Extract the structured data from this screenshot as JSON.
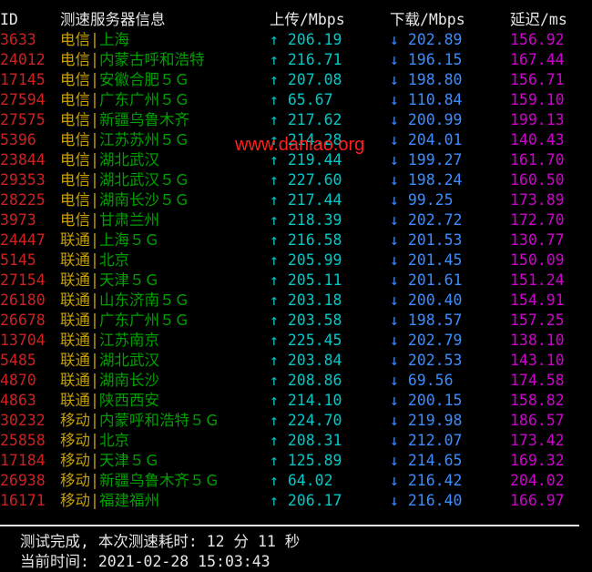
{
  "header": {
    "id": "ID",
    "server": "测速服务器信息",
    "upload": "上传/Mbps",
    "download": "下载/Mbps",
    "latency": "延迟/ms"
  },
  "watermark": "www.daniao.org",
  "rows": [
    {
      "id": "3633",
      "isp": "电信",
      "sep": "|",
      "name": "上海",
      "up": "↑ 206.19",
      "down": "↓ 202.89",
      "lat": "156.92"
    },
    {
      "id": "24012",
      "isp": "电信",
      "sep": "|",
      "name": "内蒙古呼和浩特",
      "up": "↑ 216.71",
      "down": "↓ 196.15",
      "lat": "167.44"
    },
    {
      "id": "17145",
      "isp": "电信",
      "sep": "|",
      "name": "安徽合肥５Ｇ",
      "up": "↑ 207.08",
      "down": "↓ 198.80",
      "lat": "156.71"
    },
    {
      "id": "27594",
      "isp": "电信",
      "sep": "|",
      "name": "广东广州５Ｇ",
      "up": "↑ 65.67",
      "down": "↓ 110.84",
      "lat": "159.10"
    },
    {
      "id": "27575",
      "isp": "电信",
      "sep": "|",
      "name": "新疆乌鲁木齐",
      "up": "↑ 217.62",
      "down": "↓ 200.99",
      "lat": "199.13"
    },
    {
      "id": "5396",
      "isp": "电信",
      "sep": "|",
      "name": "江苏苏州５Ｇ",
      "up": "↑ 214.28",
      "down": "↓ 204.01",
      "lat": "140.43"
    },
    {
      "id": "23844",
      "isp": "电信",
      "sep": "|",
      "name": "湖北武汉",
      "up": "↑ 219.44",
      "down": "↓ 199.27",
      "lat": "161.70"
    },
    {
      "id": "29353",
      "isp": "电信",
      "sep": "|",
      "name": "湖北武汉５Ｇ",
      "up": "↑ 227.60",
      "down": "↓ 198.24",
      "lat": "160.50"
    },
    {
      "id": "28225",
      "isp": "电信",
      "sep": "|",
      "name": "湖南长沙５Ｇ",
      "up": "↑ 217.44",
      "down": "↓ 99.25",
      "lat": "173.89"
    },
    {
      "id": "3973",
      "isp": "电信",
      "sep": "|",
      "name": "甘肃兰州",
      "up": "↑ 218.39",
      "down": "↓ 202.72",
      "lat": "172.70"
    },
    {
      "id": "24447",
      "isp": "联通",
      "sep": "|",
      "name": "上海５Ｇ",
      "up": "↑ 216.58",
      "down": "↓ 201.53",
      "lat": "130.77"
    },
    {
      "id": "5145",
      "isp": "联通",
      "sep": "|",
      "name": "北京",
      "up": "↑ 205.99",
      "down": "↓ 201.45",
      "lat": "150.09"
    },
    {
      "id": "27154",
      "isp": "联通",
      "sep": "|",
      "name": "天津５Ｇ",
      "up": "↑ 205.11",
      "down": "↓ 201.61",
      "lat": "151.24"
    },
    {
      "id": "26180",
      "isp": "联通",
      "sep": "|",
      "name": "山东济南５Ｇ",
      "up": "↑ 203.18",
      "down": "↓ 200.40",
      "lat": "154.91"
    },
    {
      "id": "26678",
      "isp": "联通",
      "sep": "|",
      "name": "广东广州５Ｇ",
      "up": "↑ 203.58",
      "down": "↓ 198.57",
      "lat": "157.25"
    },
    {
      "id": "13704",
      "isp": "联通",
      "sep": "|",
      "name": "江苏南京",
      "up": "↑ 225.45",
      "down": "↓ 202.79",
      "lat": "138.10"
    },
    {
      "id": "5485",
      "isp": "联通",
      "sep": "|",
      "name": "湖北武汉",
      "up": "↑ 203.84",
      "down": "↓ 202.53",
      "lat": "143.10"
    },
    {
      "id": "4870",
      "isp": "联通",
      "sep": "|",
      "name": "湖南长沙",
      "up": "↑ 208.86",
      "down": "↓ 69.56",
      "lat": "174.58"
    },
    {
      "id": "4863",
      "isp": "联通",
      "sep": "|",
      "name": "陕西西安",
      "up": "↑ 214.10",
      "down": "↓ 200.15",
      "lat": "158.82"
    },
    {
      "id": "30232",
      "isp": "移动",
      "sep": "|",
      "name": "内蒙呼和浩特５Ｇ",
      "up": "↑ 224.70",
      "down": "↓ 219.98",
      "lat": "186.57"
    },
    {
      "id": "25858",
      "isp": "移动",
      "sep": "|",
      "name": "北京",
      "up": "↑ 208.31",
      "down": "↓ 212.07",
      "lat": "173.42"
    },
    {
      "id": "17184",
      "isp": "移动",
      "sep": "|",
      "name": "天津５Ｇ",
      "up": "↑ 125.89",
      "down": "↓ 214.65",
      "lat": "169.32"
    },
    {
      "id": "26938",
      "isp": "移动",
      "sep": "|",
      "name": "新疆乌鲁木齐５Ｇ",
      "up": "↑ 64.02",
      "down": "↓ 216.42",
      "lat": "204.02"
    },
    {
      "id": "16171",
      "isp": "移动",
      "sep": "|",
      "name": "福建福州",
      "up": "↑ 206.17",
      "down": "↓ 216.40",
      "lat": "166.97"
    }
  ],
  "footer": {
    "done": "测试完成, 本次测速耗时: 12 分 11 秒",
    "time": "当前时间: 2021-02-28 15:03:43"
  }
}
